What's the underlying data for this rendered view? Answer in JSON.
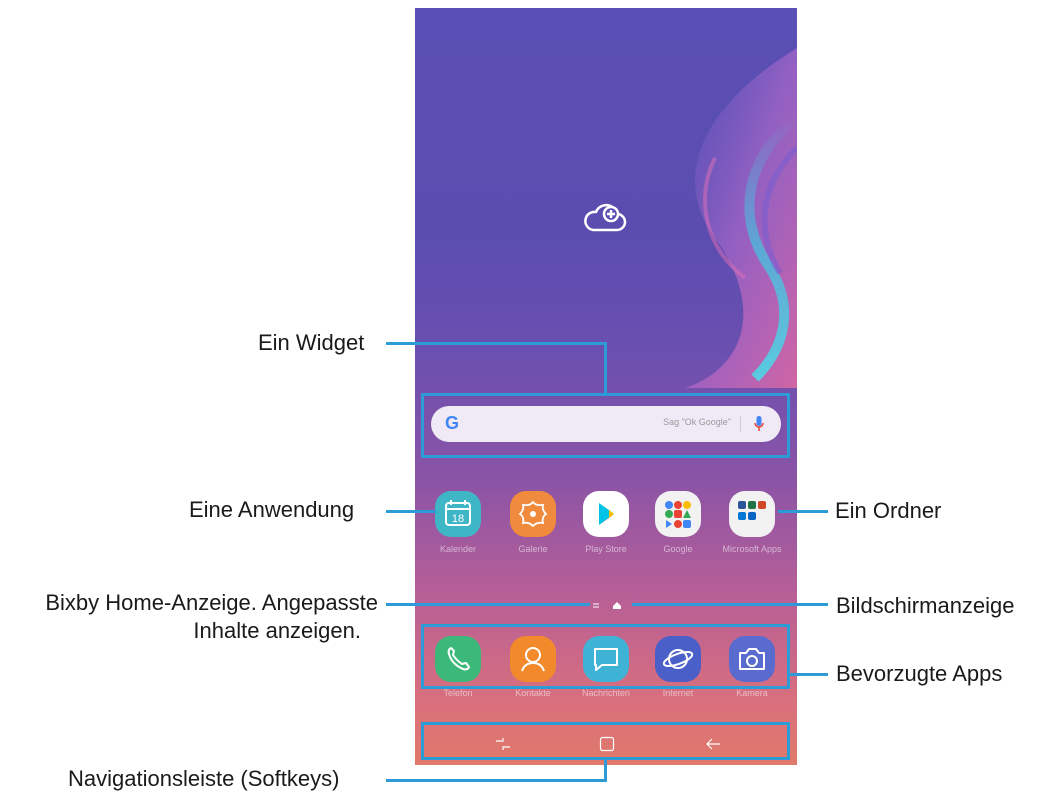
{
  "callouts": {
    "widget": "Ein Widget",
    "application": "Eine Anwendung",
    "folder": "Ein Ordner",
    "bixby_line1": "Bixby Home-Anzeige. Angepasste",
    "bixby_line2": "Inhalte anzeigen.",
    "screen_indicator": "Bildschirmanzeige",
    "favorite_apps": "Bevorzugte Apps",
    "navigation_bar": "Navigationsleiste (Softkeys)"
  },
  "phone": {
    "search_widget": {
      "logo": "G",
      "hint": "Sag \"Ok Google\"",
      "icons": [
        "google-g-icon",
        "microphone-icon"
      ]
    },
    "apps": [
      {
        "id": "calendar",
        "label": "Kalender",
        "icon": "calendar-icon",
        "day": "18",
        "color": "#3fb6c6"
      },
      {
        "id": "gallery",
        "label": "Galerie",
        "icon": "gallery-flower-icon",
        "color": "#f08a3c"
      },
      {
        "id": "play-store",
        "label": "Play Store",
        "icon": "play-store-icon",
        "color": "#ffffff"
      },
      {
        "id": "google-folder",
        "label": "Google",
        "icon": "google-folder-icon",
        "color": "#f2f2f2"
      },
      {
        "id": "microsoft-folder",
        "label": "Microsoft Apps",
        "icon": "microsoft-folder-icon",
        "color": "#f2f2f2"
      }
    ],
    "dock": [
      {
        "id": "phone",
        "label": "Telefon",
        "icon": "phone-icon",
        "color": "#3cb97a"
      },
      {
        "id": "contacts",
        "label": "Kontakte",
        "icon": "contacts-icon",
        "color": "#f28a2b"
      },
      {
        "id": "messages",
        "label": "Nachrichten",
        "icon": "messages-icon",
        "color": "#3fb3d6"
      },
      {
        "id": "internet",
        "label": "Internet",
        "icon": "internet-icon",
        "color": "#4a5fc8"
      },
      {
        "id": "camera",
        "label": "Kamera",
        "icon": "camera-icon",
        "color": "#5a6bd0"
      }
    ],
    "navigation": [
      "recent-apps-icon",
      "home-icon",
      "back-icon"
    ]
  },
  "colors": {
    "callout_line": "#2d9bd6"
  }
}
